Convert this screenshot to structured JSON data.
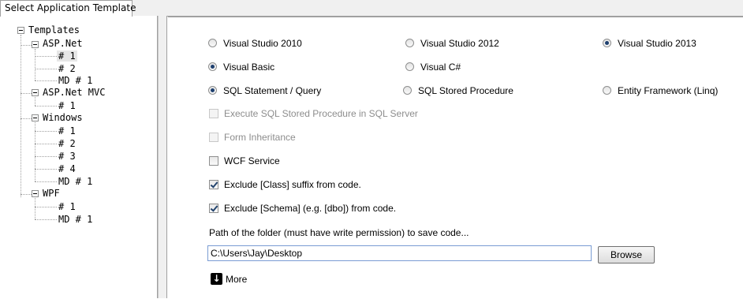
{
  "tab": {
    "label": "Select Application Template"
  },
  "tree": {
    "root": "Templates",
    "groups": [
      {
        "label": "ASP.Net",
        "items": [
          "# 1",
          "# 2",
          "MD # 1"
        ]
      },
      {
        "label": "ASP.Net MVC",
        "items": [
          "# 1"
        ]
      },
      {
        "label": "Windows",
        "items": [
          "# 1",
          "# 2",
          "# 3",
          "# 4",
          "MD # 1"
        ]
      },
      {
        "label": "WPF",
        "items": [
          "# 1",
          "MD # 1"
        ]
      }
    ]
  },
  "options": {
    "vs": {
      "vs2010": "Visual Studio 2010",
      "vs2012": "Visual Studio 2012",
      "vs2013": "Visual Studio 2013",
      "selected": "Visual Studio 2013"
    },
    "lang": {
      "vb": "Visual Basic",
      "cs": "Visual C#",
      "selected": "Visual Basic"
    },
    "data": {
      "sql": "SQL Statement / Query",
      "sp": "SQL Stored Procedure",
      "ef": "Entity Framework (Linq)",
      "selected": "SQL Statement / Query"
    },
    "exec_sp": {
      "label": "Execute SQL Stored Procedure in SQL Server",
      "checked": false,
      "enabled": false
    },
    "form_inherit": {
      "label": "Form Inheritance",
      "checked": false,
      "enabled": false
    },
    "wcf": {
      "label": "WCF Service",
      "checked": false
    },
    "exclude_class": {
      "label": "Exclude [Class] suffix from code.",
      "checked": true
    },
    "exclude_schema": {
      "label": "Exclude [Schema] (e.g. [dbo]) from code.",
      "checked": true
    }
  },
  "path": {
    "label": "Path of the folder (must have write permission) to save code...",
    "value": "C:\\Users\\Jay\\Desktop",
    "browse_label": "Browse"
  },
  "more": {
    "label": "More",
    "icon": "down-arrow-icon"
  }
}
